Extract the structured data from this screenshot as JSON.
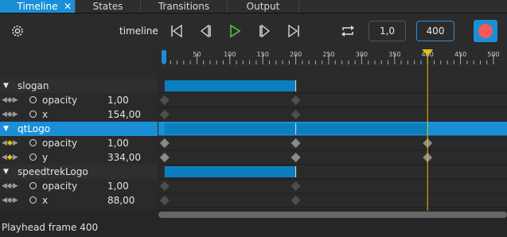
{
  "tabs": [
    {
      "label": "Timeline",
      "active": true
    },
    {
      "label": "States"
    },
    {
      "label": "Transitions"
    },
    {
      "label": "Output"
    }
  ],
  "toolbar": {
    "timeline_label": "timeline",
    "current_frame": "1,0",
    "end_frame": "400"
  },
  "ruler": {
    "ticks": [
      "0",
      "50",
      "100",
      "150",
      "200",
      "250",
      "300",
      "350",
      "400",
      "450",
      "500"
    ],
    "playhead_frame": 400,
    "frames_per_tick": 50,
    "visible_end": 500
  },
  "rows": [
    {
      "type": "group",
      "label": "slogan",
      "bar": [
        1,
        200
      ]
    },
    {
      "type": "prop",
      "label": "opacity",
      "value": "1,00",
      "keys": [
        1,
        200
      ]
    },
    {
      "type": "prop",
      "label": "x",
      "value": "154,00",
      "keys": [
        1,
        200
      ]
    },
    {
      "type": "group",
      "label": "qtLogo",
      "highlight": true,
      "bar": [
        1,
        400
      ]
    },
    {
      "type": "prop",
      "label": "opacity",
      "value": "1,00",
      "keys": [
        1,
        200,
        400
      ],
      "active": true
    },
    {
      "type": "prop",
      "label": "y",
      "value": "334,00",
      "keys": [
        1,
        200,
        400
      ],
      "active": true
    },
    {
      "type": "group",
      "label": "speedtrekLogo",
      "bar": [
        1,
        200
      ]
    },
    {
      "type": "prop",
      "label": "opacity",
      "value": "1,00",
      "keys": [
        1,
        200
      ]
    },
    {
      "type": "prop",
      "label": "x",
      "value": "88,00",
      "keys": [
        1,
        200
      ]
    }
  ],
  "status": "Playhead frame 400",
  "colors": {
    "accent": "#1b8fd6",
    "bar": "#0a7fbf",
    "playhead": "#e8c400",
    "record": "#f05a5a"
  }
}
